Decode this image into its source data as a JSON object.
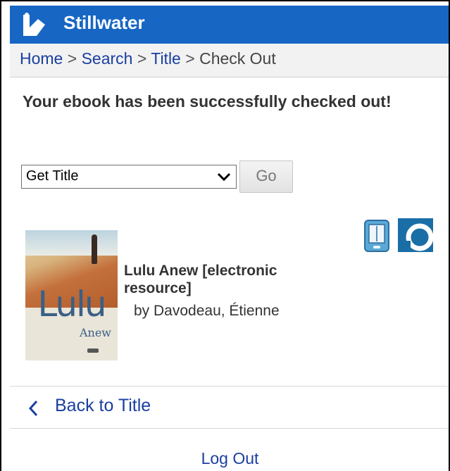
{
  "header": {
    "site_name": "Stillwater",
    "logo_icon": "library-logo-icon"
  },
  "breadcrumb": {
    "home": "Home",
    "search": "Search",
    "title": "Title",
    "current": "Check Out",
    "separator": ">"
  },
  "message": "Your ebook has been successfully checked out!",
  "action": {
    "selected": "Get Title",
    "go_label": "Go"
  },
  "book": {
    "title": "Lulu Anew [electronic resource]",
    "author": "by Davodeau, Étienne",
    "cover_title": "Lulu",
    "cover_subtitle": "Anew"
  },
  "nav": {
    "back_label": "Back to Title",
    "logout_label": "Log Out"
  },
  "colors": {
    "header_bg": "#1766c4",
    "link": "#1a3fa0"
  }
}
